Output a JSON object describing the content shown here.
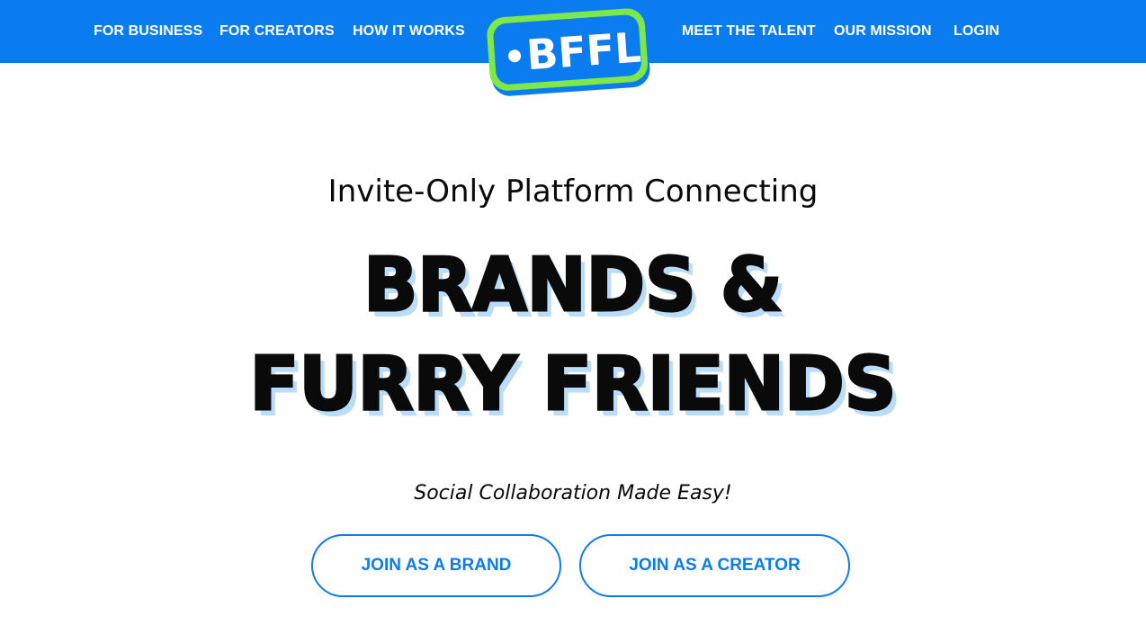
{
  "nav": {
    "left": [
      {
        "label": "FOR BUSINESS"
      },
      {
        "label": "FOR CREATORS"
      },
      {
        "label": "HOW IT WORKS"
      }
    ],
    "right": [
      {
        "label": "MEET THE TALENT"
      },
      {
        "label": "OUR MISSION"
      },
      {
        "label": "LOGIN"
      }
    ],
    "logo_text": "BFFL"
  },
  "hero": {
    "tagline": "Invite-Only Platform Connecting",
    "headline_line1": "BRANDS &",
    "headline_line2": "FURRY FRIENDS",
    "subtagline": "Social Collaboration Made Easy!",
    "cta_brand": "JOIN AS A BRAND",
    "cta_creator": "JOIN AS A CREATOR"
  },
  "colors": {
    "brand_blue": "#0a7cf0",
    "logo_green": "#7ee84a",
    "headline_shadow": "#b9dcfb"
  }
}
